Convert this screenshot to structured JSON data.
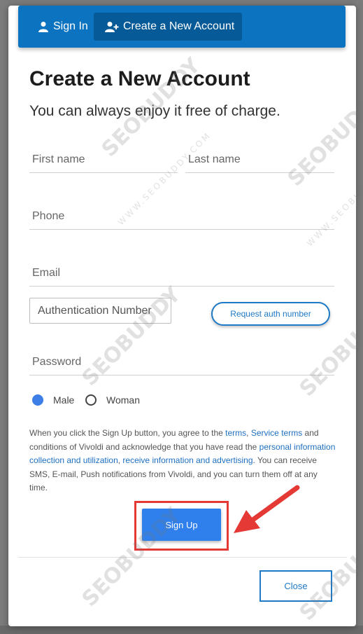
{
  "header": {
    "tabs": [
      {
        "label": "Sign In",
        "icon": "user-icon"
      },
      {
        "label": "Create a New Account",
        "icon": "user-plus-icon",
        "active": true
      }
    ],
    "color": "#0b73bf"
  },
  "form": {
    "title": "Create a New Account",
    "subtitle": "You can always enjoy it free of charge.",
    "first_name_placeholder": "First name",
    "last_name_placeholder": "Last name",
    "phone_placeholder": "Phone",
    "email_placeholder": "Email",
    "auth_placeholder": "Authentication Number",
    "auth_button": "Request auth number",
    "password_placeholder": "Password",
    "gender": {
      "options": [
        "Male",
        "Woman"
      ],
      "selected": "Male"
    },
    "consent": {
      "p1": "When you click the Sign Up button, you agree to the ",
      "terms": "terms",
      "comma": ", ",
      "service_terms": "Service terms",
      "p2": " and conditions of Vivoldi and acknowledge that you have read the ",
      "personal": "personal information collection and utilization",
      "comma2": ", ",
      "advertising": "receive information and advertising",
      "p3": ". You can receive SMS, E-mail, Push notifications from Vivoldi, and you can turn them off at any time."
    },
    "signup_button": "Sign Up",
    "close_button": "Close"
  },
  "watermark": {
    "brand": "SEOBUDDY",
    "site": "WWW.SEOBUDDY.COM"
  },
  "colors": {
    "accent": "#2f80ec",
    "link": "#1e6fc0",
    "highlight": "#e53935"
  }
}
